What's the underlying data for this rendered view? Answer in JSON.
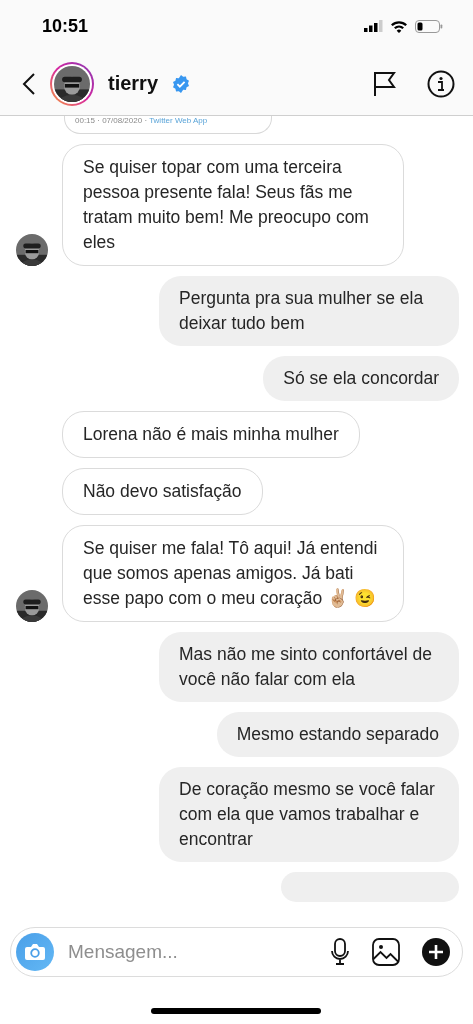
{
  "status_bar": {
    "time": "10:51"
  },
  "header": {
    "username": "tierry",
    "verified": true
  },
  "tweet_card": {
    "meta": "00:15 · 07/08/2020 · ",
    "source": "Twitter Web App"
  },
  "messages": [
    {
      "kind": "received",
      "show_avatar": true,
      "text": "Se quiser topar com uma terceira pessoa presente fala! Seus fãs me tratam muito bem! Me preocupo com eles"
    },
    {
      "kind": "sent",
      "text": "Pergunta pra sua mulher se ela deixar tudo bem"
    },
    {
      "kind": "sent",
      "text": "Só se ela concordar"
    },
    {
      "kind": "received",
      "show_avatar": false,
      "text": "Lorena não é mais minha mulher"
    },
    {
      "kind": "received",
      "show_avatar": false,
      "text": "Não devo satisfação"
    },
    {
      "kind": "received",
      "show_avatar": true,
      "text": "Se quiser me fala! Tô aqui! Já entendi que somos apenas amigos. Já bati esse papo com o meu coração ✌🏼 😉"
    },
    {
      "kind": "sent",
      "text": "Mas não me sinto confortável de você não falar com ela"
    },
    {
      "kind": "sent",
      "text": "Mesmo estando separado"
    },
    {
      "kind": "sent",
      "text": "De coração mesmo se você falar com ela que vamos trabalhar e encontrar"
    }
  ],
  "composer": {
    "placeholder": "Mensagem..."
  }
}
